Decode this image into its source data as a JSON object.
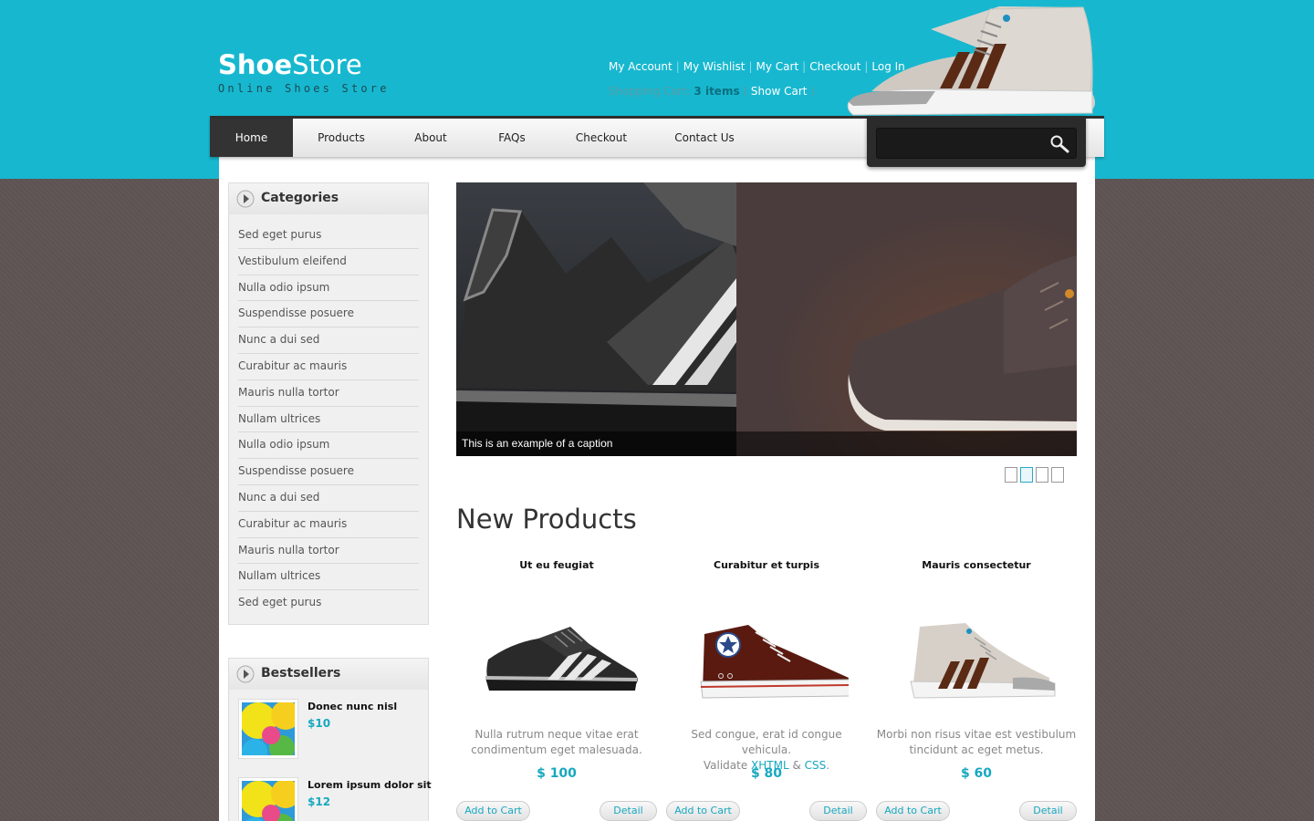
{
  "brand": {
    "bold": "Shoe",
    "light": "Store",
    "tagline": "Online Shoes Store"
  },
  "top_links": [
    "My Account",
    "My Wishlist",
    "My Cart",
    "Checkout",
    "Log In"
  ],
  "cart": {
    "prefix": "Shopping Cart:",
    "items": "3 items",
    "open": " ( ",
    "show_cart": "Show Cart",
    "close": " )"
  },
  "nav": [
    "Home",
    "Products",
    "About",
    "FAQs",
    "Checkout",
    "Contact Us"
  ],
  "search": {
    "placeholder": ""
  },
  "categories": {
    "title": "Categories",
    "items": [
      "Sed eget purus",
      "Vestibulum eleifend",
      "Nulla odio ipsum",
      "Suspendisse posuere",
      "Nunc a dui sed",
      "Curabitur ac mauris",
      "Mauris nulla tortor",
      "Nullam ultrices",
      "Nulla odio ipsum",
      "Suspendisse posuere",
      "Nunc a dui sed",
      "Curabitur ac mauris",
      "Mauris nulla tortor",
      "Nullam ultrices",
      "Sed eget purus"
    ]
  },
  "bestsellers": {
    "title": "Bestsellers",
    "items": [
      {
        "title": "Donec nunc nisl",
        "price": "$10"
      },
      {
        "title": "Lorem ipsum dolor sit",
        "price": "$12"
      }
    ]
  },
  "slider": {
    "caption": "This is an example of a caption",
    "slide_count": 4,
    "active_slide": 2
  },
  "new_products": {
    "title": "New Products",
    "items": [
      {
        "name": "Ut eu feugiat",
        "desc_1": "Nulla rutrum neque vitae erat",
        "desc_2": "condimentum eget malesuada.",
        "price": "$ 100",
        "cart_label": "Add to Cart",
        "detail_label": "Detail"
      },
      {
        "name": "Curabitur et turpis",
        "desc_1": "Sed congue, erat id congue vehicula.",
        "desc_2_prefix": "Validate ",
        "link_xhtml": "XHTML",
        "amp": " & ",
        "link_css": "CSS",
        "dot": ".",
        "price": "$ 80",
        "cart_label": "Add to Cart",
        "detail_label": "Detail"
      },
      {
        "name": "Mauris consectetur",
        "desc_1": "Morbi non risus vitae est vestibulum",
        "desc_2": "tincidunt ac eget metus.",
        "price": "$ 60",
        "cart_label": "Add to Cart",
        "detail_label": "Detail"
      }
    ]
  },
  "colors": {
    "header_bg": "#17b8cf",
    "accent": "#17a8c0",
    "nav_active": "#333333",
    "page_bg": "#5f5555"
  }
}
